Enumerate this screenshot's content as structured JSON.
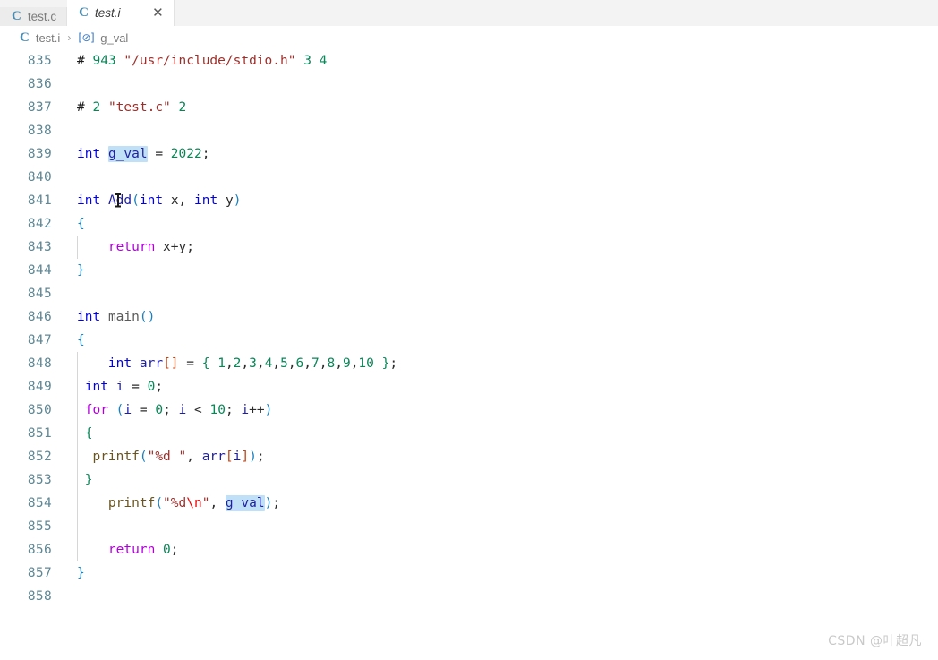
{
  "window": {
    "titlebar_color": "#808080"
  },
  "tabs": [
    {
      "icon": "c-file-icon",
      "label": "test.c",
      "active": false,
      "closable": false
    },
    {
      "icon": "c-file-icon",
      "label": "test.i",
      "active": true,
      "closable": true,
      "close_glyph": "✕"
    }
  ],
  "breadcrumb": {
    "file_icon": "c-file-icon",
    "file": "test.i",
    "separator": "›",
    "symbol_icon": "[⊘]",
    "symbol": "g_val"
  },
  "editor": {
    "language": "c",
    "first_line_number": 835,
    "highlight_color": "#bfe0f7",
    "highlighted_word": "g_val",
    "lines": [
      {
        "num": "835",
        "text": "# 943 \"/usr/include/stdio.h\" 3 4"
      },
      {
        "num": "836",
        "text": ""
      },
      {
        "num": "837",
        "text": "# 2 \"test.c\" 2"
      },
      {
        "num": "838",
        "text": ""
      },
      {
        "num": "839",
        "text": "int g_val = 2022;"
      },
      {
        "num": "840",
        "text": ""
      },
      {
        "num": "841",
        "text": "int Add(int x, int y)"
      },
      {
        "num": "842",
        "text": "{"
      },
      {
        "num": "843",
        "text": "    return x+y;"
      },
      {
        "num": "844",
        "text": "}"
      },
      {
        "num": "845",
        "text": ""
      },
      {
        "num": "846",
        "text": "int main()"
      },
      {
        "num": "847",
        "text": "{"
      },
      {
        "num": "848",
        "text": "    int arr[] = { 1,2,3,4,5,6,7,8,9,10 };"
      },
      {
        "num": "849",
        "text": " int i = 0;"
      },
      {
        "num": "850",
        "text": " for (i = 0; i < 10; i++)"
      },
      {
        "num": "851",
        "text": " {"
      },
      {
        "num": "852",
        "text": "  printf(\"%d \", arr[i]);"
      },
      {
        "num": "853",
        "text": " }"
      },
      {
        "num": "854",
        "text": "    printf(\"%d\\n\", g_val);"
      },
      {
        "num": "855",
        "text": ""
      },
      {
        "num": "856",
        "text": "    return 0;"
      },
      {
        "num": "857",
        "text": "}"
      },
      {
        "num": "858",
        "text": ""
      }
    ]
  },
  "watermark": {
    "text": "CSDN @叶超凡"
  }
}
